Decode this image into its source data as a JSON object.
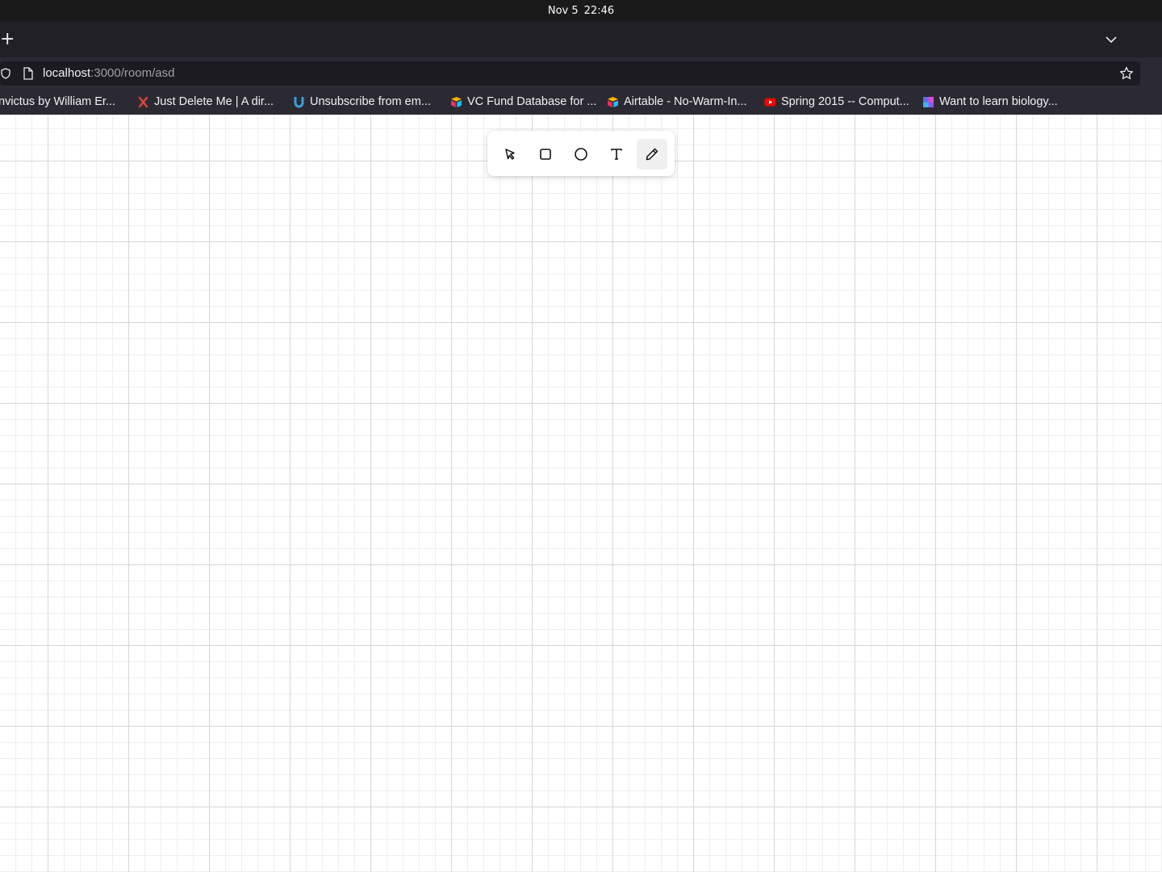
{
  "system": {
    "date": "Nov 5",
    "time": "22:46"
  },
  "browser": {
    "new_tab_glyph": "+",
    "url": {
      "host": "localhost",
      "rest": ":3000/room/asd"
    },
    "bookmarks": [
      {
        "label": "nvictus by William Er...",
        "icon": "none"
      },
      {
        "label": "Just Delete Me | A dir...",
        "icon": "x-icon",
        "color": "#e0433b"
      },
      {
        "label": "Unsubscribe from em...",
        "icon": "u-magnet-icon",
        "color": "#3aa0d8"
      },
      {
        "label": "VC Fund Database for ...",
        "icon": "airtable-icon"
      },
      {
        "label": "Airtable - No-Warm-In...",
        "icon": "airtable-icon"
      },
      {
        "label": "Spring 2015 -- Comput...",
        "icon": "youtube-icon",
        "color": "#ff0000"
      },
      {
        "label": "Want to learn biology...",
        "icon": "puzzle-icon"
      }
    ]
  },
  "toolbar": {
    "tools": [
      {
        "name": "select",
        "icon": "cursor-icon",
        "active": false
      },
      {
        "name": "rectangle",
        "icon": "square-icon",
        "active": false
      },
      {
        "name": "ellipse",
        "icon": "circle-icon",
        "active": false
      },
      {
        "name": "text",
        "icon": "text-icon",
        "active": false
      },
      {
        "name": "pencil",
        "icon": "pencil-icon",
        "active": true
      }
    ]
  }
}
